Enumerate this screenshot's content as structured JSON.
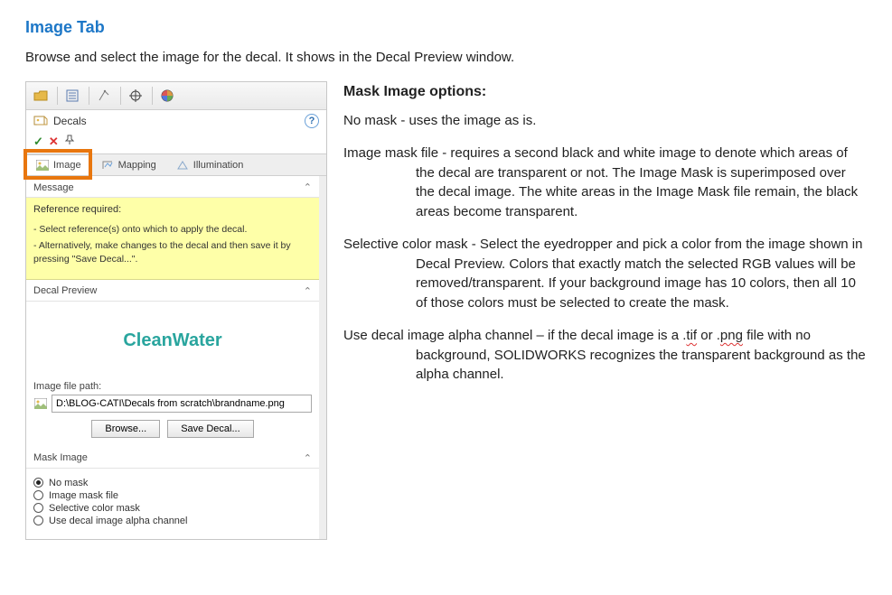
{
  "title": "Image Tab",
  "intro": "Browse and select the image for the decal. It shows in the Decal Preview window.",
  "panel": {
    "decals_label": "Decals",
    "tabs": {
      "image": "Image",
      "mapping": "Mapping",
      "illumination": "Illumination"
    },
    "sections": {
      "message": {
        "header": "Message",
        "ref": "Reference required:",
        "b1": "- Select reference(s) onto which to apply the decal.",
        "b2": "- Alternatively, make changes to the decal and then save it by pressing \"Save Decal...\"."
      },
      "preview": {
        "header": "Decal Preview",
        "logo_text": "CleanWater",
        "path_label": "Image file path:",
        "path_value": "D:\\BLOG-CATI\\Decals from scratch\\brandname.png",
        "browse": "Browse...",
        "save": "Save Decal..."
      },
      "mask": {
        "header": "Mask Image",
        "options": {
          "none": "No mask",
          "file": "Image mask file",
          "selective": "Selective color mask",
          "alpha": "Use decal image alpha channel"
        }
      }
    }
  },
  "right": {
    "heading": "Mask Image options:",
    "no_mask": "No mask - uses the image as is.",
    "image_mask_lead": "Image mask file - ",
    "image_mask_rest": "requires a second black and white image to denote which areas of the decal are transparent or not. The Image Mask is superimposed over the decal image. The white areas in the Image Mask file remain, the black areas become transparent.",
    "selective_lead": "Selective color mask - ",
    "selective_rest": " Select the eyedropper and pick a color from the image shown in Decal Preview.  Colors that exactly match the selected RGB values will be removed/transparent.  If your background image has 10 colors, then all 10 of those colors must be selected to create the mask.",
    "alpha_lead": "Use decal image alpha channel – ",
    "alpha_mid_a": "if the decal image is a .",
    "alpha_tif": "tif",
    "alpha_mid_b": " or .",
    "alpha_png": "png",
    "alpha_tail": " file with no background, SOLIDWORKS recognizes the transparent background as the alpha channel."
  }
}
